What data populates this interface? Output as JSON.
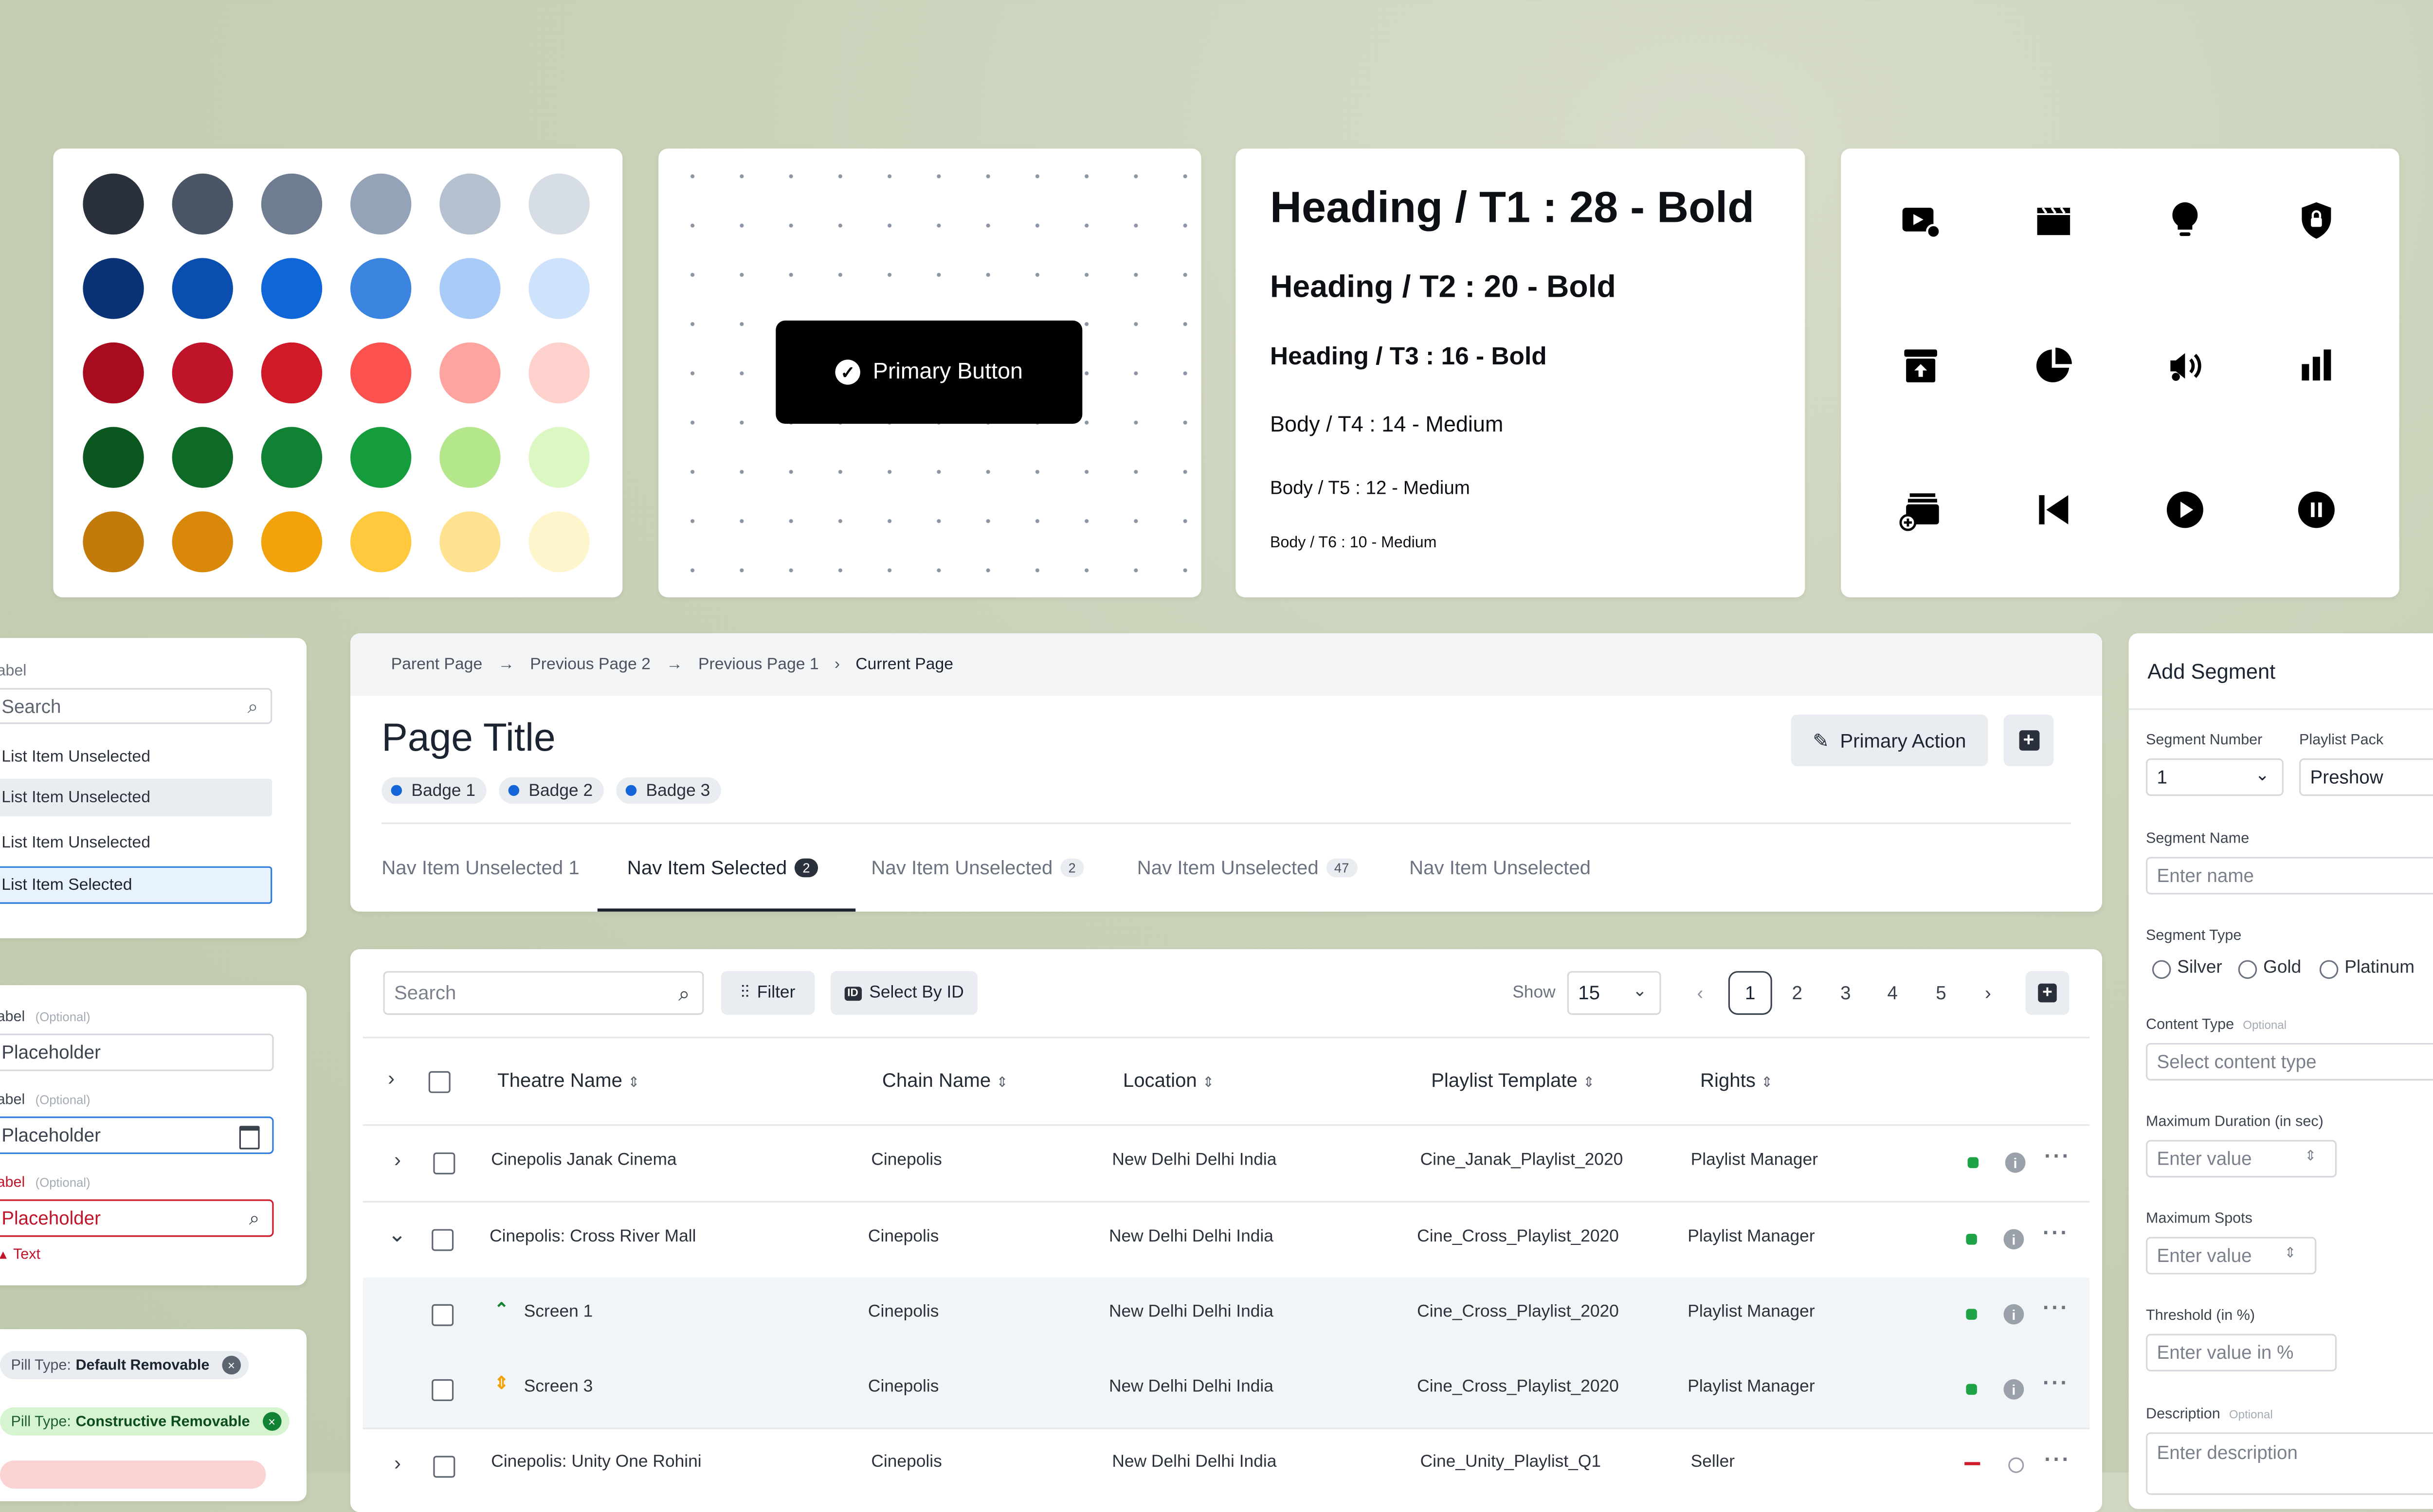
{
  "palette": {
    "rows": [
      [
        "#2a313c",
        "#4a5666",
        "#6f7d92",
        "#94a3b8",
        "#b6c1cf",
        "#d6dde5"
      ],
      [
        "#0a3277",
        "#0a4fb0",
        "#0f66d8",
        "#3b84e0",
        "#a9cbf7",
        "#cfe2fc"
      ],
      [
        "#a80a1f",
        "#c0142a",
        "#d11a28",
        "#fb524f",
        "#fda4a0",
        "#ffd1cc"
      ],
      [
        "#0b5720",
        "#0d6a27",
        "#118234",
        "#159c3c",
        "#b4e68b",
        "#dbf7c2"
      ],
      [
        "#c27b0a",
        "#da880a",
        "#f2a20a",
        "#ffc83d",
        "#ffe290",
        "#fff5cc"
      ]
    ]
  },
  "button_demo": {
    "label": "Primary Button"
  },
  "typography": {
    "t1": "Heading / T1 : 28 -  Bold",
    "t2": "Heading / T2 : 20 - Bold",
    "t3": "Heading / T3 : 16 - Bold",
    "t4": "Body / T4 : 14 - Medium",
    "t5": "Body / T5 : 12 - Medium",
    "t6": "Body / T6 : 10 - Medium"
  },
  "icons": [
    "video-play-icon",
    "clapperboard-icon",
    "lightbulb-icon",
    "shield-lock-icon",
    "archive-upload-icon",
    "pie-chart-icon",
    "volume-music-icon",
    "bar-chart-icon",
    "stack-add-icon",
    "skip-previous-icon",
    "play-circle-icon",
    "pause-circle-icon"
  ],
  "list_panel": {
    "label": "abel",
    "search_placeholder": "Search",
    "items": [
      "List Item Unselected",
      "List Item Unselected",
      "List Item Unselected",
      "List Item Selected"
    ]
  },
  "form_panel": {
    "fields": [
      {
        "label": "abel",
        "optional": "(Optional)",
        "placeholder": "Placeholder"
      },
      {
        "label": "abel",
        "optional": "(Optional)",
        "placeholder": "Placeholder"
      },
      {
        "label": "abel",
        "optional": "(Optional)",
        "placeholder": "Placeholder",
        "error": "Text"
      }
    ]
  },
  "pills": {
    "items": [
      {
        "key": "Pill Type:",
        "value": "Default Removable"
      },
      {
        "key": "Pill Type:",
        "value": "Constructive Removable"
      }
    ]
  },
  "header": {
    "breadcrumb": [
      "Parent Page",
      "Previous Page 2",
      "Previous Page 1",
      "Current Page"
    ],
    "title": "Page Title",
    "primary_action": "Primary Action",
    "badges": [
      "Badge 1",
      "Badge 2",
      "Badge 3"
    ],
    "tabs": [
      {
        "label": "Nav Item Unselected 1",
        "count": ""
      },
      {
        "label": "Nav Item Selected",
        "count": "2"
      },
      {
        "label": "Nav Item Unselected",
        "count": "2"
      },
      {
        "label": "Nav Item Unselected",
        "count": "47"
      },
      {
        "label": "Nav Item Unselected",
        "count": ""
      }
    ]
  },
  "table": {
    "search_placeholder": "Search",
    "filter_label": "Filter",
    "select_by_id_label": "Select By ID",
    "show_label": "Show",
    "show_value": "15",
    "pages": [
      "1",
      "2",
      "3",
      "4",
      "5"
    ],
    "columns": [
      "Theatre Name",
      "Chain Name",
      "Location",
      "Playlist Template",
      "Rights"
    ],
    "rows": [
      {
        "name": "Cinepolis Janak Cinema",
        "chain": "Cinepolis",
        "location": "New Delhi  Delhi  India",
        "template": "Cine_Janak_Playlist_2020",
        "rights": "Playlist Manager"
      },
      {
        "name": "Cinepolis: Cross River Mall",
        "chain": "Cinepolis",
        "location": "New Delhi  Delhi  India",
        "template": "Cine_Cross_Playlist_2020",
        "rights": "Playlist Manager"
      },
      {
        "name": "Screen 1",
        "chain": "Cinepolis",
        "location": "New Delhi  Delhi  India",
        "template": "Cine_Cross_Playlist_2020",
        "rights": "Playlist Manager"
      },
      {
        "name": "Screen 3",
        "chain": "Cinepolis",
        "location": "New Delhi  Delhi  India",
        "template": "Cine_Cross_Playlist_2020",
        "rights": "Playlist Manager"
      },
      {
        "name": "Cinepolis: Unity One Rohini",
        "chain": "Cinepolis",
        "location": "New Delhi  Delhi  India",
        "template": "Cine_Unity_Playlist_Q1",
        "rights": "Seller"
      }
    ]
  },
  "segment": {
    "title": "Add Segment",
    "segment_number_label": "Segment Number",
    "segment_number_value": "1",
    "playlist_pack_label": "Playlist Pack",
    "playlist_pack_value": "Preshow",
    "segment_name_label": "Segment Name",
    "segment_name_placeholder": "Enter name",
    "segment_type_label": "Segment Type",
    "segment_types": [
      "Silver",
      "Gold",
      "Platinum"
    ],
    "content_type_label": "Content Type",
    "optional": "Optional",
    "content_type_placeholder": "Select content type",
    "max_duration_label": "Maximum Duration (in sec)",
    "max_duration_placeholder": "Enter value",
    "max_spots_label": "Maximum Spots",
    "max_spots_placeholder": "Enter value",
    "threshold_label": "Threshold (in %)",
    "threshold_placeholder": "Enter value in %",
    "description_label": "Description",
    "description_placeholder": "Enter description"
  }
}
